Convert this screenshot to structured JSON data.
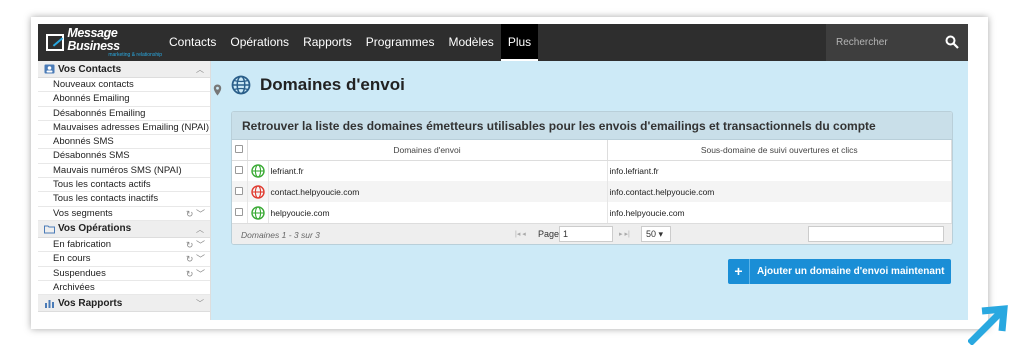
{
  "brand": {
    "title": "Message Business",
    "subtitle": "marketing & relationship",
    "accent": "#29a8e0"
  },
  "nav": {
    "items": [
      "Contacts",
      "Opérations",
      "Rapports",
      "Programmes",
      "Modèles",
      "Plus"
    ],
    "active": "Plus"
  },
  "search": {
    "placeholder": "Rechercher",
    "icon": "search-icon"
  },
  "sidebar": {
    "contacts_header": "Vos Contacts",
    "contacts": [
      "Nouveaux contacts",
      "Abonnés Emailing",
      "Désabonnés Emailing",
      "Mauvaises adresses Emailing (NPAI)",
      "Abonnés SMS",
      "Désabonnés SMS",
      "Mauvais numéros SMS (NPAI)",
      "Tous les contacts actifs",
      "Tous les contacts inactifs",
      "Vos segments"
    ],
    "operations_header": "Vos Opérations",
    "operations": [
      "En fabrication",
      "En cours",
      "Suspendues",
      "Archivées"
    ],
    "reports_header": "Vos Rapports"
  },
  "main": {
    "title": "Domaines d'envoi",
    "panel_title": "Retrouver la liste des domaines émetteurs utilisables pour les envois d'emailings et transactionnels du compte",
    "columns": [
      "Domaines d'envoi",
      "Sous-domaine de suivi ouvertures et clics"
    ],
    "rows": [
      {
        "domain": "lefriant.fr",
        "subdomain": "info.lefriant.fr",
        "status_color": "#3aaa35"
      },
      {
        "domain": "contact.helpyoucie.com",
        "subdomain": "info.contact.helpyoucie.com",
        "status_color": "#e03a2f"
      },
      {
        "domain": "helpyoucie.com",
        "subdomain": "info.helpyoucie.com",
        "status_color": "#3aaa35"
      }
    ],
    "pager": {
      "count": "Domaines  1 - 3 sur 3",
      "page_label": "Page",
      "page_value": "1",
      "page_size": "50"
    },
    "add_button": "Ajouter un domaine d'envoi maintenant"
  }
}
